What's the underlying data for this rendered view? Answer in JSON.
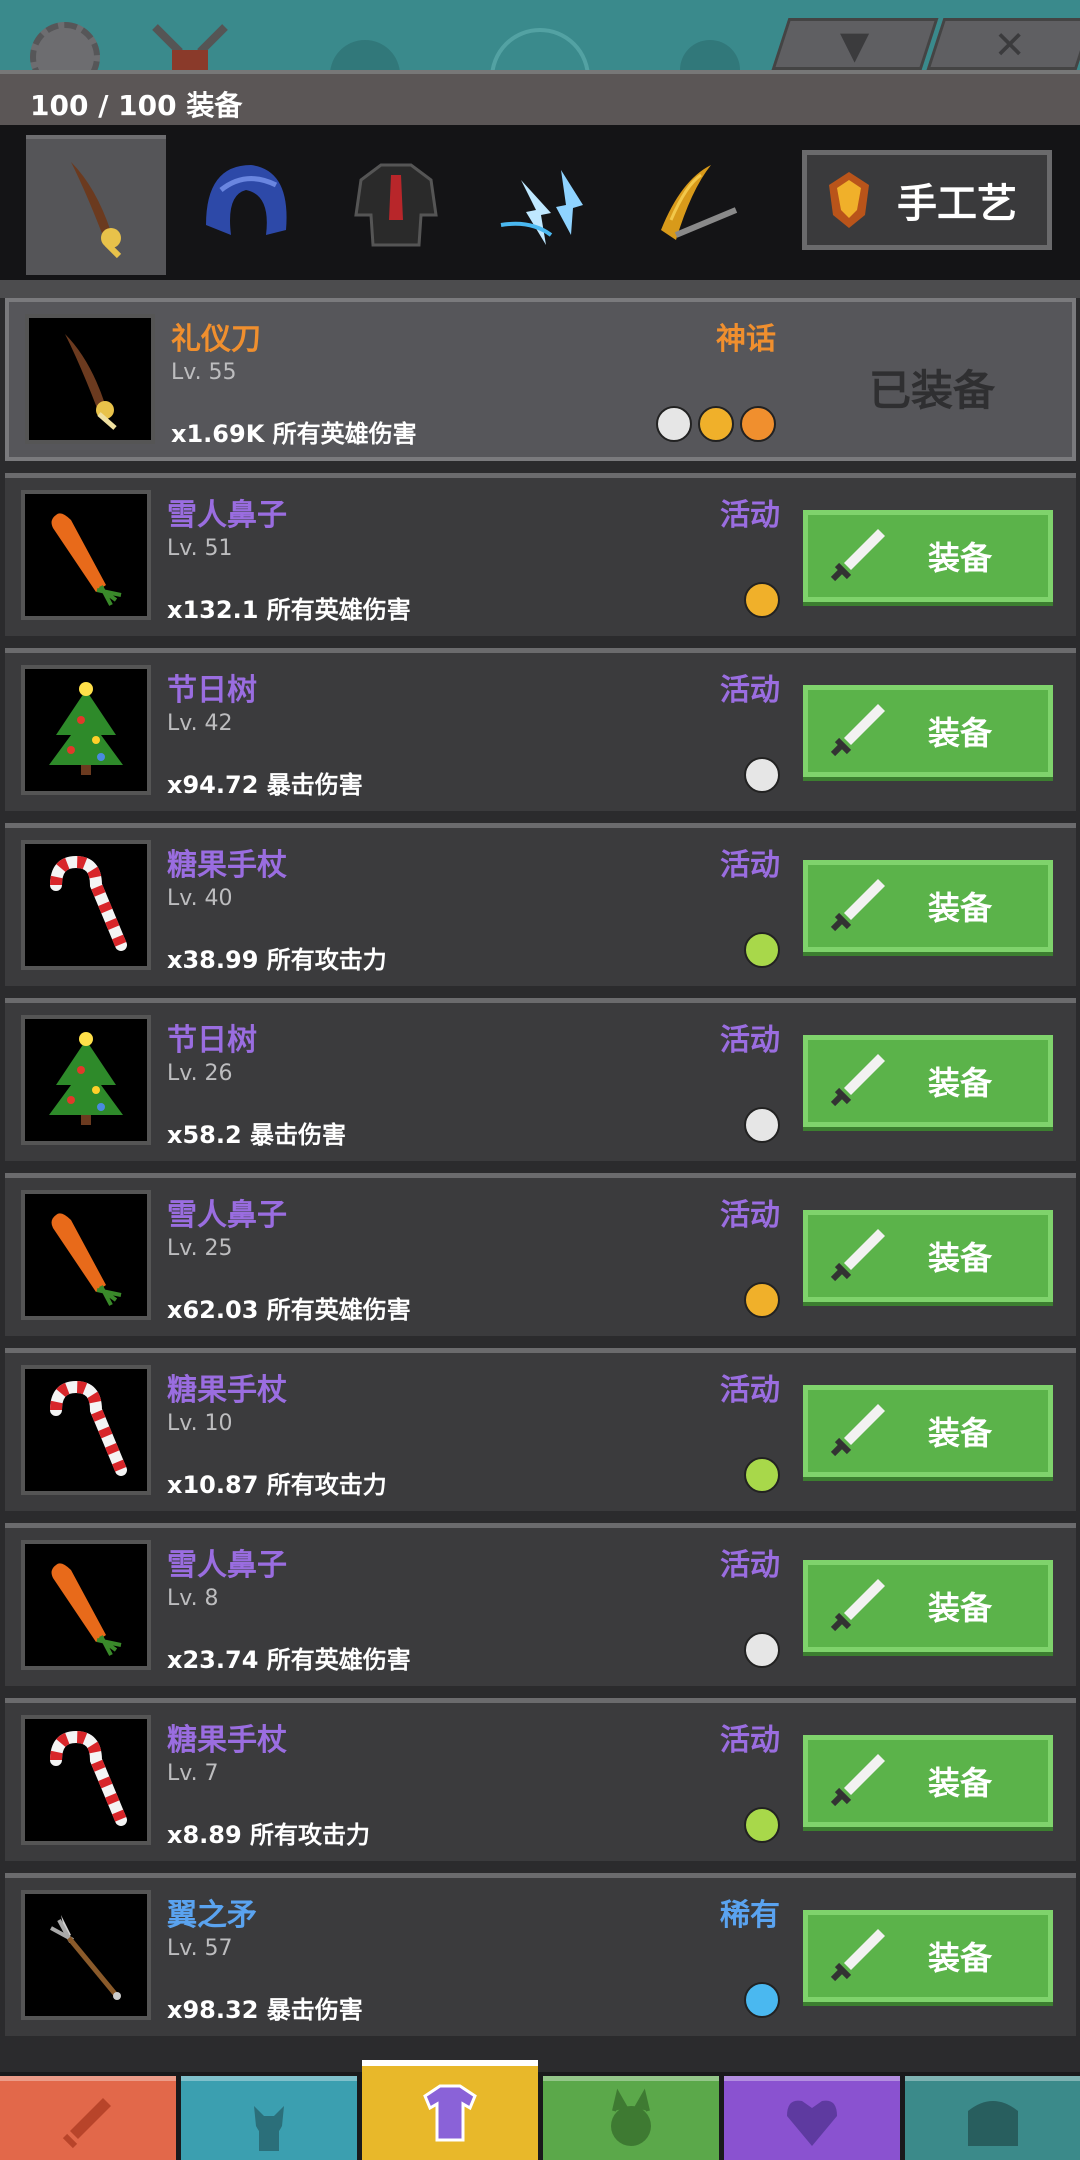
{
  "header": {
    "count_label": "100 / 100 装备"
  },
  "top_tabs": {
    "dropdown_glyph": "▼",
    "close_glyph": "✕"
  },
  "categories": {
    "tabs": [
      {
        "icon": "weapon-icon",
        "active": true
      },
      {
        "icon": "helmet-icon",
        "active": false
      },
      {
        "icon": "armor-icon",
        "active": false
      },
      {
        "icon": "lightning-aura-icon",
        "active": false
      },
      {
        "icon": "slash-effect-icon",
        "active": false
      }
    ],
    "craft_label": "手工艺"
  },
  "colors": {
    "mythic": "#f08f2e",
    "event": "#9a6de0",
    "rare": "#5aa3f0",
    "equip_green": "#5bb34a"
  },
  "items": [
    {
      "name": "礼仪刀",
      "level": "Lv. 55",
      "stat": "x1.69K 所有英雄伤害",
      "rarity": "神话",
      "rarity_class": "rar-mythic",
      "thumb": "ceremonial-sword-icon",
      "heroes": [
        "warrior-hero-icon",
        "archer-hero-icon",
        "blade-hero-icon"
      ],
      "equipped": true,
      "equipped_label": "已装备"
    },
    {
      "name": "雪人鼻子",
      "level": "Lv. 51",
      "stat": "x132.1 所有英雄伤害",
      "rarity": "活动",
      "rarity_class": "rar-event",
      "thumb": "carrot-icon",
      "heroes": [
        "archer-hero-icon"
      ],
      "button_label": "装备"
    },
    {
      "name": "节日树",
      "level": "Lv. 42",
      "stat": "x94.72 暴击伤害",
      "rarity": "活动",
      "rarity_class": "rar-event",
      "thumb": "christmas-tree-icon",
      "heroes": [
        "warrior-hero-icon"
      ],
      "button_label": "装备"
    },
    {
      "name": "糖果手杖",
      "level": "Lv. 40",
      "stat": "x38.99 所有攻击力",
      "rarity": "活动",
      "rarity_class": "rar-event",
      "thumb": "candy-cane-icon",
      "heroes": [
        "leaf-hero-icon"
      ],
      "button_label": "装备"
    },
    {
      "name": "节日树",
      "level": "Lv. 26",
      "stat": "x58.2 暴击伤害",
      "rarity": "活动",
      "rarity_class": "rar-event",
      "thumb": "christmas-tree-icon",
      "heroes": [
        "warrior-hero-icon"
      ],
      "button_label": "装备"
    },
    {
      "name": "雪人鼻子",
      "level": "Lv. 25",
      "stat": "x62.03 所有英雄伤害",
      "rarity": "活动",
      "rarity_class": "rar-event",
      "thumb": "carrot-icon",
      "heroes": [
        "archer-hero-icon"
      ],
      "button_label": "装备"
    },
    {
      "name": "糖果手杖",
      "level": "Lv. 10",
      "stat": "x10.87 所有攻击力",
      "rarity": "活动",
      "rarity_class": "rar-event",
      "thumb": "candy-cane-icon",
      "heroes": [
        "leaf-hero-icon"
      ],
      "button_label": "装备"
    },
    {
      "name": "雪人鼻子",
      "level": "Lv. 8",
      "stat": "x23.74 所有英雄伤害",
      "rarity": "活动",
      "rarity_class": "rar-event",
      "thumb": "carrot-icon",
      "heroes": [
        "warrior-hero-icon"
      ],
      "button_label": "装备"
    },
    {
      "name": "糖果手杖",
      "level": "Lv. 7",
      "stat": "x8.89 所有攻击力",
      "rarity": "活动",
      "rarity_class": "rar-event",
      "thumb": "candy-cane-icon",
      "heroes": [
        "leaf-hero-icon"
      ],
      "button_label": "装备"
    },
    {
      "name": "翼之矛",
      "level": "Lv. 57",
      "stat": "x98.32 暴击伤害",
      "rarity": "稀有",
      "rarity_class": "rar-rare",
      "thumb": "winged-spear-icon",
      "heroes": [
        "ice-hero-icon"
      ],
      "button_label": "装备"
    }
  ],
  "bottom_nav": [
    {
      "icon": "sword-nav-icon",
      "color": "#e2684a"
    },
    {
      "icon": "hero-nav-icon",
      "color": "#3b9fb0"
    },
    {
      "icon": "shirt-nav-icon",
      "color": "#e8b82a",
      "active": true
    },
    {
      "icon": "pet-nav-icon",
      "color": "#5ba84a"
    },
    {
      "icon": "guild-nav-icon",
      "color": "#8a52d0"
    },
    {
      "icon": "chest-nav-icon",
      "color": "#3b8a8a"
    }
  ]
}
